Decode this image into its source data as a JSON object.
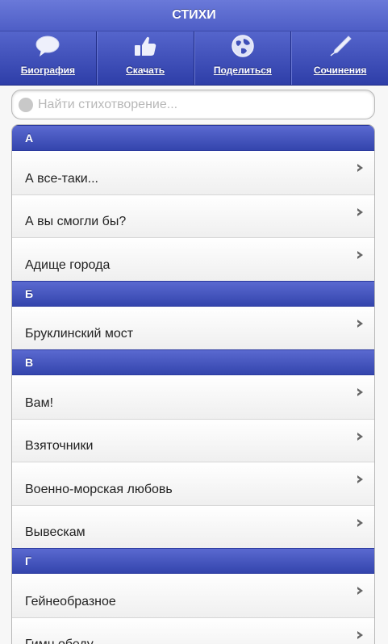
{
  "header": {
    "title": "СТИХИ"
  },
  "navbar": {
    "items": [
      {
        "label": "Биография",
        "icon": "speech-bubble-icon"
      },
      {
        "label": "Скачать",
        "icon": "thumbs-up-icon"
      },
      {
        "label": "Поделиться",
        "icon": "globe-icon"
      },
      {
        "label": "Сочинения",
        "icon": "pen-icon"
      }
    ]
  },
  "search": {
    "placeholder": "Найти стихотворение...",
    "value": ""
  },
  "list": {
    "sections": [
      {
        "letter": "А",
        "items": [
          "А все-таки...",
          "А вы смогли бы?",
          "Адище города"
        ]
      },
      {
        "letter": "Б",
        "items": [
          "Бруклинский мост"
        ]
      },
      {
        "letter": "В",
        "items": [
          "Вам!",
          "Взяточники",
          "Военно-морская любовь",
          "Вывескам"
        ]
      },
      {
        "letter": "Г",
        "items": [
          "Гейнеобразное",
          "Гимн обеду"
        ]
      }
    ]
  },
  "colors": {
    "bar": "#4e5ec6",
    "divider": "#3a4ab1",
    "text": "#222222"
  }
}
